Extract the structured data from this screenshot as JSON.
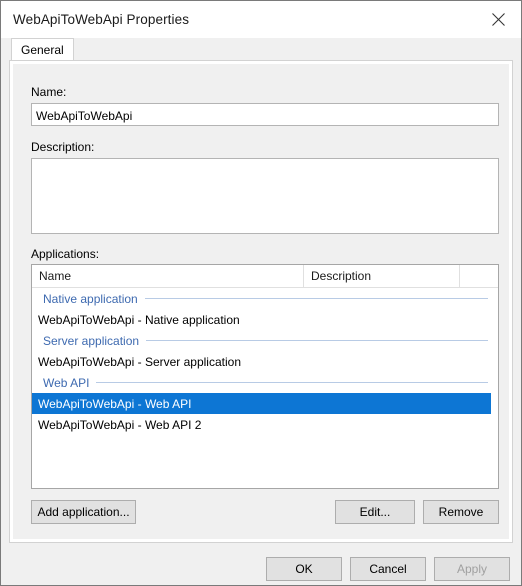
{
  "window": {
    "title": "WebApiToWebApi Properties",
    "close_icon": "close-icon"
  },
  "tabs": [
    {
      "label": "General",
      "selected": true
    }
  ],
  "form": {
    "name_label": "Name:",
    "name_value": "WebApiToWebApi",
    "name_placeholder": "",
    "description_label": "Description:",
    "description_value": "",
    "description_placeholder": "",
    "applications_label": "Applications:"
  },
  "list": {
    "columns": [
      "Name",
      "Description",
      ""
    ],
    "groups": [
      {
        "header": "Native application",
        "rows": [
          {
            "name": "WebApiToWebApi - Native application",
            "description": "",
            "selected": false
          }
        ]
      },
      {
        "header": "Server application",
        "rows": [
          {
            "name": "WebApiToWebApi - Server application",
            "description": "",
            "selected": false
          }
        ]
      },
      {
        "header": "Web API",
        "rows": [
          {
            "name": "WebApiToWebApi - Web API",
            "description": "",
            "selected": true
          },
          {
            "name": "WebApiToWebApi - Web API 2",
            "description": "",
            "selected": false
          }
        ]
      }
    ],
    "selection_color": "#0d76d4",
    "group_header_color": "#3e6ab0"
  },
  "list_buttons": {
    "add": "Add application...",
    "edit": "Edit...",
    "remove": "Remove"
  },
  "dialog_buttons": {
    "ok": "OK",
    "cancel": "Cancel",
    "apply": "Apply",
    "apply_disabled": true
  }
}
